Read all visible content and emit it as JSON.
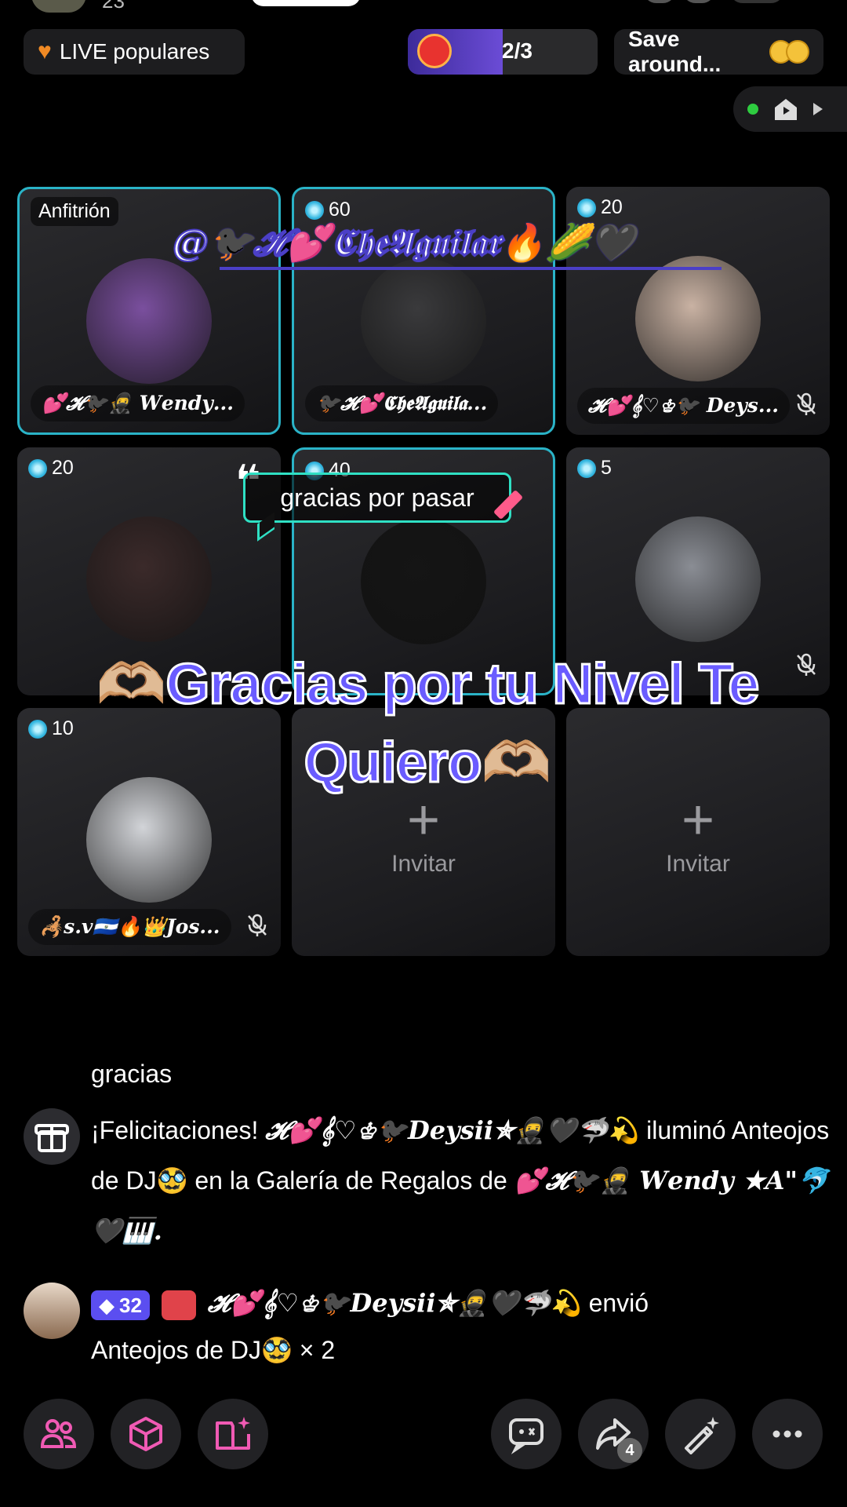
{
  "header": {
    "viewer_count": "23",
    "live_popular_label": "LIVE populares",
    "progress_label": "2/3",
    "progress_fraction": 0.5,
    "save_label": "Save around..."
  },
  "mention_overlay": "@🐦‍⬛𝓗💕𝕮𝖍𝖊𝕬𝖌𝖚𝖎𝖑𝖆𝖗🔥🌽🖤",
  "speech_bubble": "gracias por pasar",
  "big_caption": "🫶🏼Gracias por tu Nivel Te Quiero🫶🏼",
  "host_tag": "Anfitrión",
  "tiles": [
    {
      "badge": "",
      "name": "💕𝓗🐦‍⬛🥷 𝑾𝒆𝒏𝒅𝒚...",
      "muted": false,
      "highlight": true,
      "avatar_color": "#7a4f9e"
    },
    {
      "badge": "60",
      "name": "🐦‍⬛𝓗💕𝕮𝖍𝖊𝕬𝖌𝖚𝖎𝖑𝖆...",
      "muted": false,
      "highlight": true,
      "avatar_color": "#3a3a3c"
    },
    {
      "badge": "20",
      "name": "𝓗💕𝄞♡♔🐦‍⬛ 𝑫𝒆𝒚𝒔...",
      "muted": true,
      "highlight": false,
      "avatar_color": "#c9b2a3"
    },
    {
      "badge": "20",
      "name": "",
      "muted": false,
      "highlight": false,
      "avatar_color": "#3b2a2a"
    },
    {
      "badge": "40",
      "name": "",
      "muted": false,
      "highlight": true,
      "avatar_color": "#151515"
    },
    {
      "badge": "5",
      "name": "",
      "muted": true,
      "highlight": false,
      "avatar_color": "#8a8d94"
    },
    {
      "badge": "10",
      "name": "🦂s.v🇸🇻🔥👑Jos...",
      "muted": true,
      "highlight": false,
      "avatar_color": "#d2d4d8"
    }
  ],
  "invite_label": "Invitar",
  "chat": [
    {
      "text": "gracias"
    },
    {
      "prefix": "¡Felicitaciones!",
      "user": "𝓗💕𝄞♡♔🐦‍⬛𝑫𝒆𝒚𝒔𝒊𝒊✯🥷🖤🦈💫",
      "line_a": " iluminó Anteojos de DJ🥸 en la Galería de Regalos de ",
      "target": "💕𝓗🐦‍⬛🥷 𝑾𝒆𝒏𝒅𝒚 ★𝑨\"🐬🖤🎹."
    },
    {
      "level": "32",
      "user": "𝓗💕𝄞♡♔🐦‍⬛𝑫𝒆𝒚𝒔𝒊𝒊✯🥷🖤🦈💫",
      "action": " envió",
      "gift": "Anteojos de DJ🥸 × 2"
    }
  ],
  "share_count": "4",
  "colors": {
    "accent": "#6a5cff",
    "highlight_border": "#2ab3c7",
    "bubble_border": "#2fe0c4"
  },
  "bottom_icons": [
    "guests-icon",
    "box-icon",
    "book-sparkle-icon",
    "chat-game-icon",
    "share-icon",
    "magic-wand-icon",
    "more-icon"
  ]
}
